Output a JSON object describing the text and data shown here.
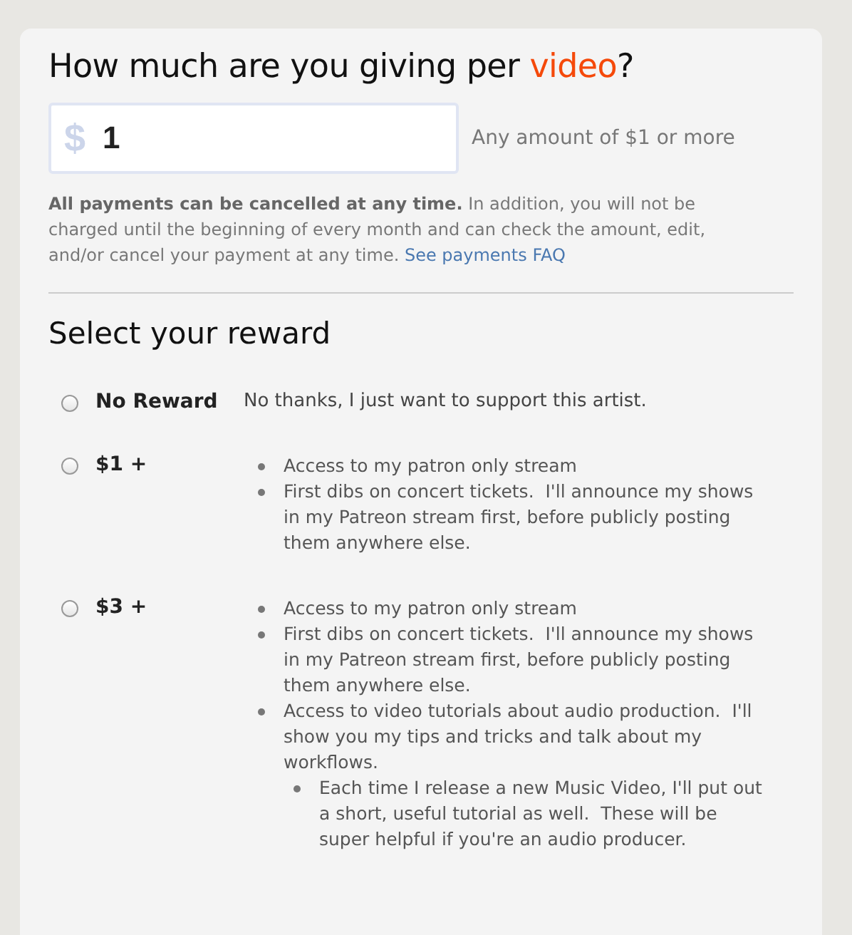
{
  "pledge": {
    "title": {
      "before": "How much are you giving per ",
      "highlight": "video",
      "after": "?"
    },
    "amount": {
      "currency": "$",
      "value": "1"
    },
    "hint": "Any amount of $1 or more",
    "note": "**All payments can be cancelled at any time.** In addition, you will not be charged until the beginning of every month and can check the amount, edit, and/or cancel your payment at any time.",
    "faq_link": "See payments FAQ"
  },
  "rewards": {
    "title": "Select your reward",
    "options": [
      {
        "label": "No Reward",
        "selected": false,
        "kind": "text",
        "description": "No thanks, I just want to support this artist."
      },
      {
        "label": "$1 +",
        "selected": false,
        "kind": "list",
        "items": [
          {
            "text": "Access to my patron only stream"
          },
          {
            "text": "First dibs on concert tickets.  I'll announce my shows in my Patreon stream first, before publicly posting them anywhere else."
          }
        ]
      },
      {
        "label": "$3 +",
        "selected": false,
        "kind": "list",
        "items": [
          {
            "text": "Access to my patron only stream"
          },
          {
            "text": "First dibs on concert tickets.  I'll announce my shows in my Patreon stream first, before publicly posting them anywhere else."
          },
          {
            "text": "Access to video tutorials about audio production.  I'll show you my tips and tricks and talk about my workflows.",
            "children": [
              {
                "text": "Each time I release a new Music Video, I'll put out a short, useful tutorial as well.  These will be super helpful if you're an audio producer."
              }
            ]
          }
        ]
      }
    ]
  }
}
